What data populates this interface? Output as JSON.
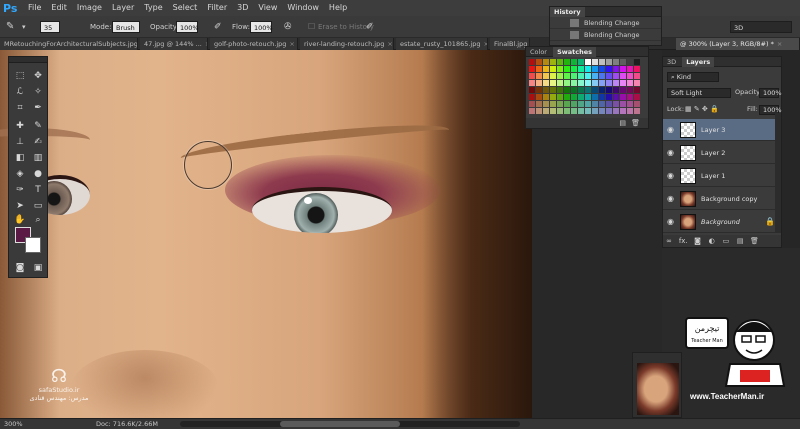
{
  "app": {
    "logo": "Ps"
  },
  "menu": [
    "File",
    "Edit",
    "Image",
    "Layer",
    "Type",
    "Select",
    "Filter",
    "3D",
    "View",
    "Window",
    "Help"
  ],
  "options": {
    "brush_size": "35",
    "mode_label": "Mode:",
    "mode_value": "Brush",
    "opacity_label": "Opacity:",
    "opacity_value": "100%",
    "flow_label": "Flow:",
    "flow_value": "100%",
    "erase_history": "Erase to History",
    "workspace": "3D"
  },
  "tabs": [
    "MRetouchingForArchitecturalSubjects.jpg",
    "47.jpg @ 144% ...",
    "golf-photo-retouch.jpg",
    "river-landing-retouch.jpg",
    "estate_rusty_101865.jpg",
    "FinalBl.jpg",
    "@ 300% (Layer 3, RGB/8#) *"
  ],
  "history": {
    "title": "History",
    "items": [
      "Blending Change",
      "Blending Change"
    ]
  },
  "color_panel": {
    "tab_color": "Color",
    "tab_swatches": "Swatches"
  },
  "layers": {
    "tab_3d": "3D",
    "tab_layers": "Layers",
    "kind": "Kind",
    "blend_mode": "Soft Light",
    "opacity_label": "Opacity:",
    "opacity_value": "100%",
    "lock_label": "Lock:",
    "fill_label": "Fill:",
    "fill_value": "100%",
    "items": [
      {
        "name": "Layer 3",
        "selected": true
      },
      {
        "name": "Layer 2",
        "selected": false
      },
      {
        "name": "Layer 1",
        "selected": false
      },
      {
        "name": "Background copy",
        "selected": false
      },
      {
        "name": "Background",
        "selected": false
      }
    ],
    "footer": [
      "∞",
      "fx.",
      "◙",
      "◐",
      "▭",
      "▤",
      "🗑"
    ]
  },
  "status": {
    "zoom": "300%",
    "doc": "Doc: 716.6K/2.66M"
  },
  "watermark": {
    "logo_text": "safaStudio.ir",
    "subtitle": "مدرس: مهندس قنادی"
  },
  "teacher": {
    "badge": "تیچرمن",
    "name": "Teacher Man",
    "url": "www.TeacherMan.ir"
  },
  "colors": {
    "foreground": "#5a1a45",
    "background": "#ffffff",
    "layer_selected": "#5a6b84",
    "accent": "#31a8ff"
  }
}
